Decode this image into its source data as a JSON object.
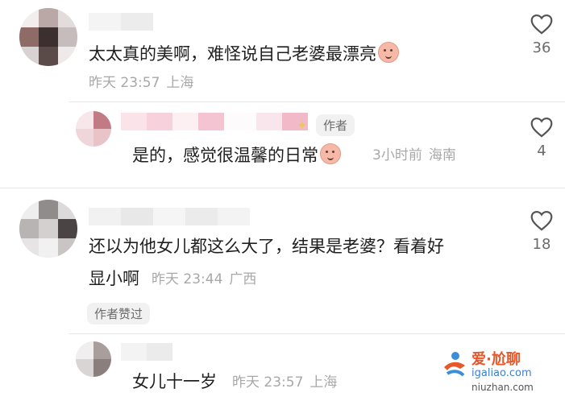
{
  "comments": [
    {
      "text": "太太真的美啊，难怪说自己老婆最漂亮",
      "time": "昨天 23:57",
      "location": "上海",
      "likes": "36"
    },
    {
      "tag": "作者",
      "text": "是的，感觉很温馨的日常",
      "time": "3小时前",
      "location": "海南",
      "likes": "4"
    },
    {
      "text_line1": "还以为他女儿都这么大了，结果是老婆？看着好",
      "text_line2": "显小啊",
      "time": "昨天 23:44",
      "location": "广西",
      "likes": "18",
      "badge": "作者赞过"
    },
    {
      "text": "女儿十一岁",
      "time": "昨天 23:57",
      "location": "上海"
    }
  ],
  "watermark": {
    "brand": "爱·尬聊",
    "site": "igaliao.com",
    "site2": "niuzhan.com"
  },
  "colors": {
    "text": "#1f1f1f",
    "meta": "#a8a8a8",
    "count": "#6b6b6b",
    "tag_bg": "#f1f1f1"
  }
}
